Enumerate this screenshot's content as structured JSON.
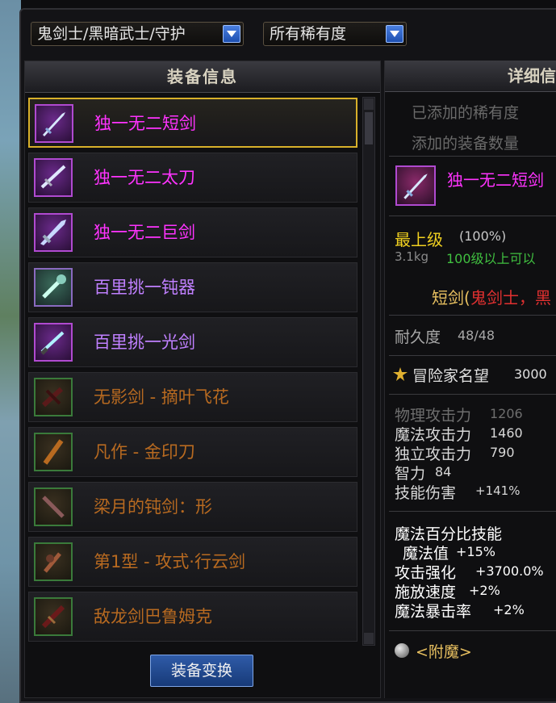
{
  "filters": {
    "class_value": "鬼剑士/黑暗武士/守护",
    "rarity_value": "所有稀有度"
  },
  "left_panel": {
    "title": "装备信息",
    "items": [
      {
        "label": "独一无二短剑",
        "color": "#ff33ff",
        "icon": "short-sword-icon"
      },
      {
        "label": "独一无二太刀",
        "color": "#ff33ff",
        "icon": "katana-icon"
      },
      {
        "label": "独一无二巨剑",
        "color": "#ff33ff",
        "icon": "greatsword-icon"
      },
      {
        "label": "百里挑一钝器",
        "color": "#c080ff",
        "icon": "blunt-weapon-icon"
      },
      {
        "label": "百里挑一光剑",
        "color": "#c080ff",
        "icon": "lightsaber-icon"
      },
      {
        "label": "无影剑 - 摘叶飞花",
        "color": "#b86a20",
        "icon": "shadow-sword-icon"
      },
      {
        "label": "凡作 - 金印刀",
        "color": "#b86a20",
        "icon": "gold-seal-blade-icon"
      },
      {
        "label": "梁月的钝剑：形",
        "color": "#b86a20",
        "icon": "blunt-sword-icon"
      },
      {
        "label": "第1型 - 攻式·行云剑",
        "color": "#b86a20",
        "icon": "cloud-sword-icon"
      },
      {
        "label": "敌龙剑巴鲁姆克",
        "color": "#b86a20",
        "icon": "dragon-sword-icon"
      }
    ],
    "swap_button": "装备变换"
  },
  "right_panel": {
    "title": "详细信",
    "added_rarity": "已添加的稀有度",
    "added_count": "添加的装备数量",
    "item_name": "独一无二短剑",
    "level_label": "最上级",
    "level_pct": "(100%)",
    "weight": "3.1kg",
    "level_req": "100级以上可以",
    "type_prefix": "短剑(",
    "type_classes": "鬼剑士，黑",
    "durability_label": "耐久度",
    "durability_value": "48/48",
    "fame_label": "冒险家名望",
    "fame_value": "3000",
    "stats": [
      {
        "label": "物理攻击力",
        "value": "1206"
      },
      {
        "label": "魔法攻击力",
        "value": "1460"
      },
      {
        "label": "独立攻击力",
        "value": "790"
      },
      {
        "label": "智力",
        "value": "84"
      },
      {
        "label": "技能伤害",
        "value": "+141%"
      }
    ],
    "magic_skill_title": "魔法百分比技能",
    "magic_mp_label": "魔法值",
    "magic_mp_value": "+15%",
    "attack_boost_label": "攻击强化",
    "attack_boost_value": "+3700.0%",
    "cast_speed_label": "施放速度",
    "cast_speed_value": "+2%",
    "magic_crit_label": "魔法暴击率",
    "magic_crit_value": "+2%",
    "enchant": "<附魔>"
  },
  "colors": {
    "legendary": "#ff33ff",
    "epic": "#c080ff",
    "unique_orange": "#b86a20",
    "level_yellow": "#f0d020",
    "req_green": "#40c040",
    "class_red": "#e03030",
    "selected_border": "#d8b02a"
  }
}
